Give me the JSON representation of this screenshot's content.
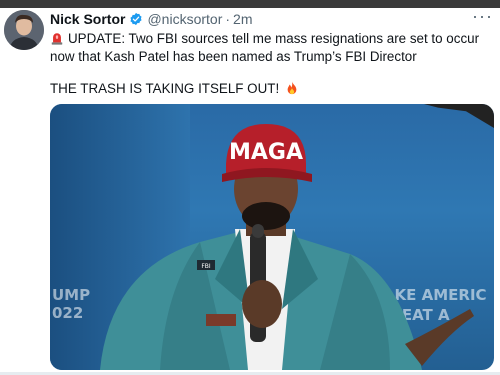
{
  "tweet": {
    "author_name": "Nick Sortor",
    "handle": "@nicksortor",
    "separator": "·",
    "time": "2m",
    "text_line1": "UPDATE: Two FBI sources tell me mass resignations are set to occur now that Kash Patel has been named as Trump’s FBI Director",
    "text_line2": "THE TRASH IS TAKING ITSELF OUT!",
    "more_label": "···",
    "hat_text": "MAGA",
    "pin_text": "FBI",
    "background_text_left": "UMP",
    "background_text_left2": "022",
    "background_text_right": "MAKE AMERIC",
    "background_text_right2": "GREAT A"
  },
  "colors": {
    "verified_badge": "#1d9bf0",
    "text_primary": "#0f1419",
    "text_secondary": "#536471",
    "hat_red": "#b61f2a"
  },
  "icons": [
    "avatar",
    "verified-badge-icon",
    "siren-emoji-icon",
    "fire-emoji-icon",
    "more-options-icon"
  ]
}
